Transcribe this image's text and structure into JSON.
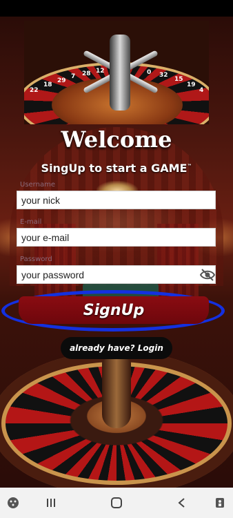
{
  "welcome_title": "Welcome",
  "subtitle": "SingUp to start a GAME",
  "subtitle_mark": "™",
  "form": {
    "username_label": "Username",
    "username_value": "your nick",
    "email_label": "E-mail",
    "email_value": "your e-mail",
    "password_label": "Password",
    "password_value": "your password"
  },
  "signup_label": "SignUp",
  "login_label": "already have? Login",
  "hero_numbers": [
    "22",
    "18",
    "29",
    "7",
    "28",
    "12",
    "0",
    "32",
    "15",
    "19",
    "4"
  ],
  "colors": {
    "signup_button": "#7a0a10",
    "highlight_ring": "#1430e0",
    "login_pill": "#0b0b0b"
  },
  "icons": {
    "password_toggle": "eye-off-icon",
    "nav_left": "game-icon",
    "nav_recent": "recent-apps-icon",
    "nav_home": "home-icon",
    "nav_back": "back-icon",
    "nav_right": "accessibility-icon"
  }
}
